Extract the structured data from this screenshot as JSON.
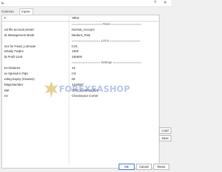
{
  "window": {
    "title": "lo",
    "help_glyph": "?",
    "close_glyph": "✕"
  },
  "tabs": [
    {
      "label": "Common"
    },
    {
      "label": "Inputs"
    }
  ],
  "table": {
    "headers": [
      "e",
      "Value"
    ],
    "rows": [
      [
        "",
        "================= Risks ================="
      ],
      [
        "ost file account preset",
        "Normal_Account"
      ],
      [
        "sk Management Mode",
        "Medium_Risk"
      ],
      [
        "",
        "================ LOTS ================="
      ],
      [
        "ctor for Fixed_Lotmode",
        "0.01"
      ],
      [
        "s/Daily Trades",
        "1000"
      ],
      [
        "ily Profit Limit",
        "150000"
      ],
      [
        "",
        "================ Settings ================"
      ],
      [
        "tor Distance",
        "15"
      ],
      [
        "ax Spread in Pips",
        "0.5"
      ],
      [
        "nding Expiry (minutes)",
        "60"
      ],
      [
        "MagicNumber",
        "1234567"
      ],
      [
        "age",
        "Gold_Scalping_Bot"
      ],
      [
        "ror",
        "Chooseyour Corner"
      ],
      [
        "",
        ""
      ],
      [
        "",
        ""
      ],
      [
        "",
        ""
      ],
      [
        "",
        ""
      ],
      [
        "",
        ""
      ],
      [
        "",
        ""
      ],
      [
        "",
        ""
      ],
      [
        "",
        ""
      ],
      [
        "",
        ""
      ],
      [
        "",
        ""
      ],
      [
        "",
        ""
      ],
      [
        "",
        ""
      ]
    ]
  },
  "watermark": {
    "text": "FOREXEASHOP"
  },
  "buttons": {
    "load": "Load",
    "save": "Save",
    "ok": "OK",
    "cancel": "Cancel",
    "reset": "Reset"
  }
}
